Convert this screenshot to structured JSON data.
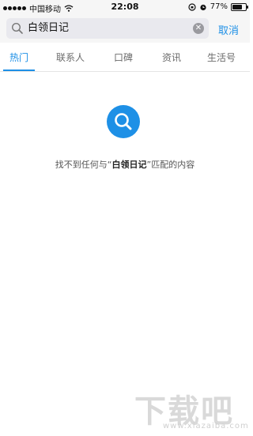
{
  "status_bar": {
    "carrier": "中国移动",
    "time": "22:08",
    "battery": "77%"
  },
  "search": {
    "query": "白领日记",
    "cancel_label": "取消"
  },
  "tabs": [
    {
      "label": "热门",
      "active": true
    },
    {
      "label": "联系人",
      "active": false
    },
    {
      "label": "口碑",
      "active": false
    },
    {
      "label": "资讯",
      "active": false
    },
    {
      "label": "生活号",
      "active": false
    }
  ],
  "empty_state": {
    "prefix": "找不到任何与“",
    "keyword": "白领日记",
    "suffix": "”匹配的内容"
  },
  "watermark": {
    "text_cn": "下载吧",
    "text_en": "www.xiazaiba.com"
  },
  "colors": {
    "accent": "#1e90e6",
    "tab_inactive": "#6b6b6b",
    "header_bg": "#f6f6f6"
  },
  "icons": [
    "signal-dots-icon",
    "wifi-icon",
    "search-icon",
    "clear-icon",
    "lock-rotation-icon",
    "alarm-icon",
    "battery-icon"
  ]
}
